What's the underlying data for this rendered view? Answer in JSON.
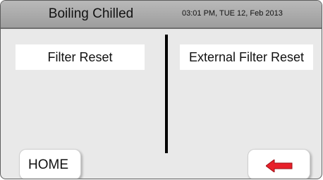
{
  "header": {
    "title": "Boiling Chilled",
    "datetime": "03:01 PM, TUE 12, Feb 2013"
  },
  "main": {
    "left_option_label": "Filter Reset",
    "right_option_label": "External Filter Reset"
  },
  "footer": {
    "home_label": "HOME",
    "back_icon": "red-left-arrow-icon"
  },
  "colors": {
    "background": "#e9e9e9",
    "header": "#a9a9a9",
    "button": "#ffffff",
    "arrow": "#e8202a"
  }
}
